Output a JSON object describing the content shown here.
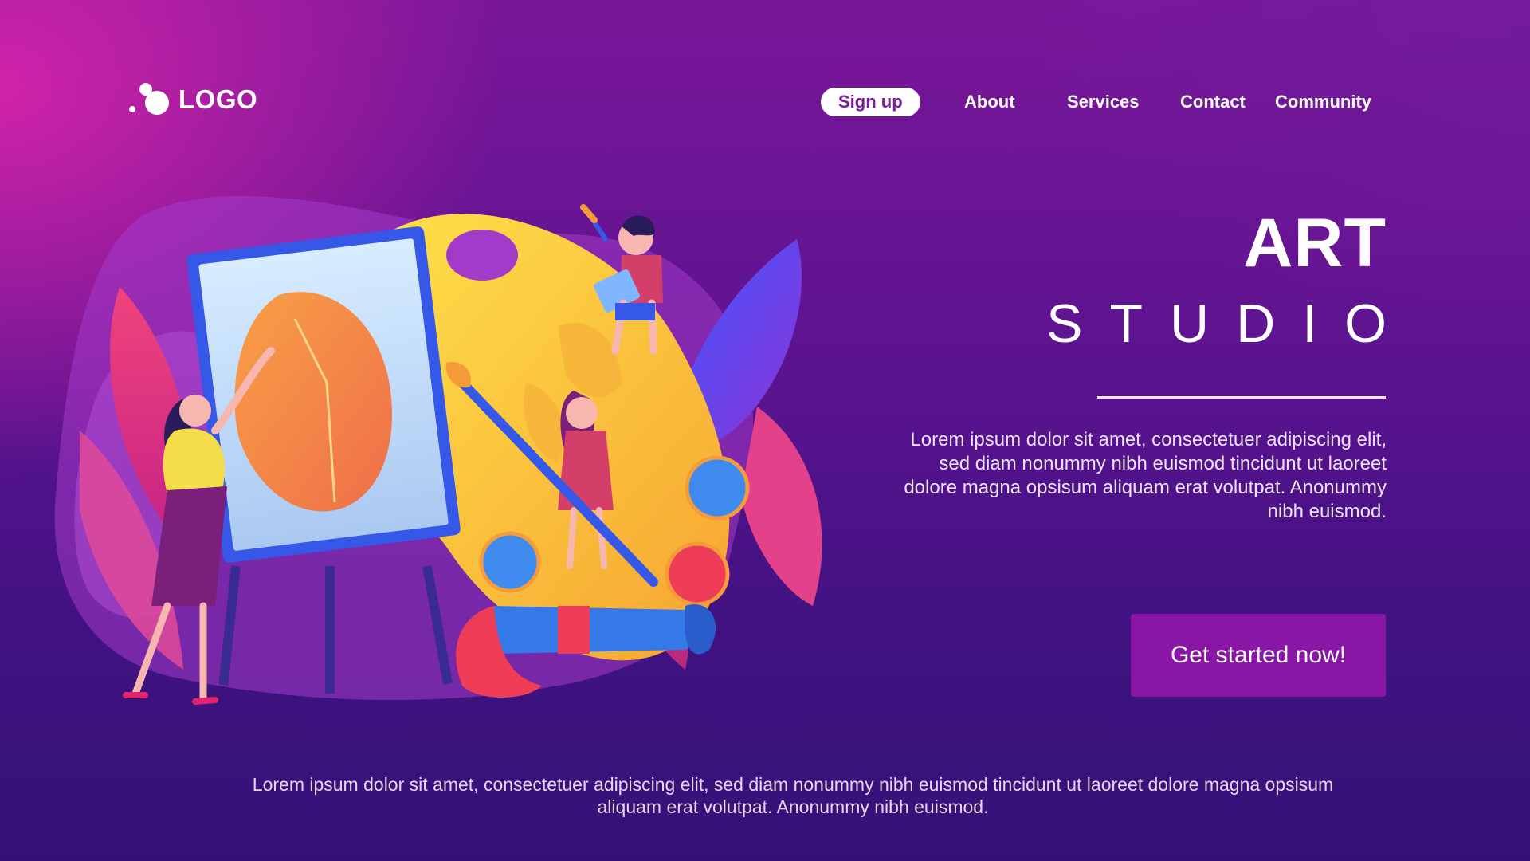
{
  "header": {
    "logo_text": "LOGO",
    "nav": [
      "Sign up",
      "About",
      "Services",
      "Contact",
      "Community"
    ]
  },
  "hero": {
    "title_line1": "ART",
    "title_line2": "STUDIO",
    "description": "Lorem ipsum dolor sit amet, consectetuer adipiscing elit, sed diam nonummy nibh euismod tincidunt ut laoreet dolore magna opsisum aliquam erat volutpat. Anonummy nibh euismod.",
    "cta_label": "Get started now!"
  },
  "footer": {
    "text": "Lorem ipsum dolor sit amet, consectetuer adipiscing elit, sed diam nonummy nibh euismod tincidunt ut laoreet dolore magna opsisum aliquam erat volutpat. Anonummy nibh euismod."
  },
  "colors": {
    "brand": "#8a16a6",
    "signup_text": "#7a1a9e",
    "background_top": "#d624aa",
    "background_bottom": "#351177"
  }
}
